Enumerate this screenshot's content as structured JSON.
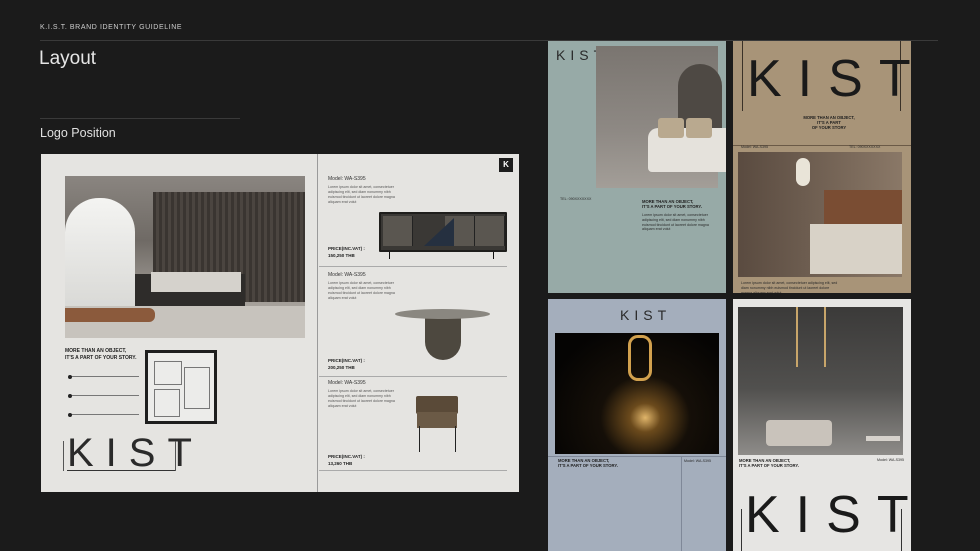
{
  "header": {
    "guideline": "K.I.S.T. BRAND IDENTITY GUIDELINE"
  },
  "page": {
    "title": "Layout",
    "section": "Logo Position"
  },
  "spread": {
    "badge": "K",
    "tagline_1": "MORE THAN AN OBJECT,",
    "tagline_2": "IT'S A PART OF YOUR STORY.",
    "logo": "KIST",
    "products": [
      {
        "model": "Model: WA-S395",
        "desc": "Lorem ipsum dolor sit amet, consectetuer adipiscing elit, sed diam nonummy nibh euismod tincidunt ut laoreet dolore magna aliquam erat volut",
        "price_label": "PRICE(INC.VAT) :",
        "price": "150,250 THB"
      },
      {
        "model": "Model: WA-S395",
        "desc": "Lorem ipsum dolor sit amet, consectetuer adipiscing elit, sed diam nonummy nibh euismod tincidunt ut laoreet dolore magna aliquam erat volut",
        "price_label": "PRICE(INC.VAT) :",
        "price": "200,250 THB"
      },
      {
        "model": "Model: WA-S395",
        "desc": "Lorem ipsum dolor sit amet, consectetuer adipiscing elit, sed diam nonummy nibh euismod tincidunt ut laoreet dolore magna aliquam erat volut",
        "price_label": "PRICE(INC.VAT) :",
        "price": "13,260 THB"
      }
    ]
  },
  "posters": {
    "p1": {
      "logo": "KIST",
      "tagline_1": "MORE THAN AN OBJECT,",
      "tagline_2": "IT'S A PART OF YOUR STORY.",
      "body": "Lorem ipsum dolor sit amet, consectetuer adipiscing elit, sed diam nonummy nibh euismod tincidunt ut laoreet dolore magna aliquam erat volut",
      "foot": "TEL: 090XXXXXXX"
    },
    "p2": {
      "logo": "KIST",
      "tagline_1": "MORE THAN AN OBJECT,",
      "tagline_2": "IT'S A PART",
      "tagline_3": "OF YOUR STORY",
      "model": "Model: WA-S395",
      "tel": "TEL: 090XXXXXXX",
      "body": "Lorem ipsum dolor sit amet, consectetuer adipiscing elit, sed diam nonummy nibh euismod tincidunt ut laoreet dolore magna aliquam erat volut"
    },
    "p3": {
      "logo": "KIST",
      "tagline_1": "MORE THAN AN OBJECT,",
      "tagline_2": "IT'S A PART OF YOUR STORY.",
      "model": "Model: WA-S395"
    },
    "p4": {
      "tagline_1": "MORE THAN AN OBJECT,",
      "tagline_2": "IT'S A PART OF YOUR STORY.",
      "model": "Model: WA-S395",
      "logo": "KIST"
    }
  }
}
